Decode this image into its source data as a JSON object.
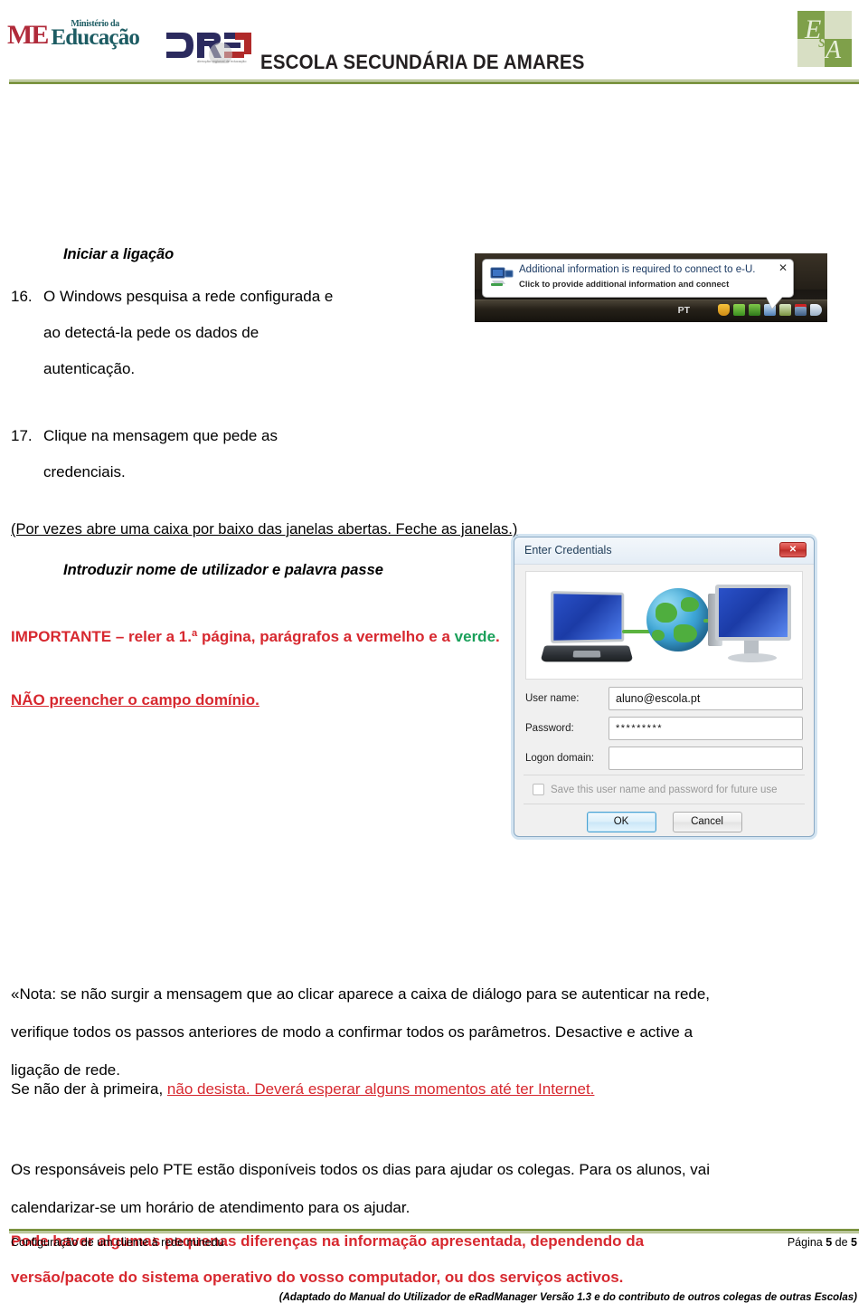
{
  "header": {
    "ministry_top": "Ministério    da",
    "ministry_main": "Educação",
    "dren_label": "DREN",
    "school_title": "ESCOLA SECUNDÁRIA DE AMARES",
    "esa_logo": "ESA"
  },
  "body": {
    "subhead1": "Iniciar a ligação",
    "item16": {
      "number": "16.",
      "line1": "O Windows pesquisa a rede configurada e",
      "line2": "ao detectá-la pede os dados de",
      "line3": "autenticação."
    },
    "item17": {
      "number": "17.",
      "line1": "Clique na mensagem que pede as",
      "line2": "credenciais."
    },
    "paren_note": "(Por vezes abre uma caixa por baixo das janelas abertas. Feche as janelas.)",
    "subhead2": "Introduzir nome de utilizador e palavra passe",
    "important_part1": "IMPORTANTE – reler a 1.ª página, parágrafos a vermelho e a ",
    "important_green": "verde",
    "important_end": ".",
    "nao_preencher": "NÃO preencher o campo domínio.",
    "nota_line1": "«Nota: se não surgir a mensagem que ao clicar aparece a caixa de diálogo para se autenticar na rede,",
    "nota_line2": "verifique todos os passos anteriores de modo a confirmar todos os parâmetros. Desactive e active a",
    "nota_line3": "ligação de rede.",
    "senao_plain": "Se não der à primeira, ",
    "senao_red": "não desista. Deverá esperar alguns momentos até ter Internet.",
    "resp_line1": "Os responsáveis pelo PTE estão disponíveis todos os dias para ajudar os colegas. Para os alunos, vai",
    "resp_line2": "calendarizar-se um horário de atendimento para os ajudar.",
    "pode_line1": "Pode haver algumas pequenas diferenças na informação apresentada, dependendo da",
    "pode_line2": "versão/pacote do sistema operativo do vosso computador, ou dos serviços activos.",
    "adaptado": "(Adaptado do Manual do Utilizador de eRadManager Versão 1.3 e do contributo de outros colegas de outras Escolas)"
  },
  "notification": {
    "title": "Additional information is required to connect to e-U.",
    "subtitle": "Click to provide additional information and connect",
    "close": "✕",
    "tray_lang": "PT"
  },
  "credentials_dialog": {
    "title": "Enter Credentials",
    "close_glyph": "✕",
    "username_label": "User name:",
    "username_value": "aluno@escola.pt",
    "password_label": "Password:",
    "password_value": "*********",
    "domain_label": "Logon domain:",
    "domain_value": "",
    "save_label": "Save this user name and password for future use",
    "ok_label": "OK",
    "cancel_label": "Cancel"
  },
  "footer": {
    "left": "Configuração de um cliente à rede minedu",
    "right_prefix": "Página ",
    "page_current": "5",
    "right_mid": " de ",
    "page_total": "5"
  },
  "colors": {
    "rule_green": "#7c9442",
    "alert_red": "#d7282f",
    "accent_green": "#1aa05a",
    "ministry_teal": "#1d5c63",
    "ministry_red": "#b02a3a"
  }
}
